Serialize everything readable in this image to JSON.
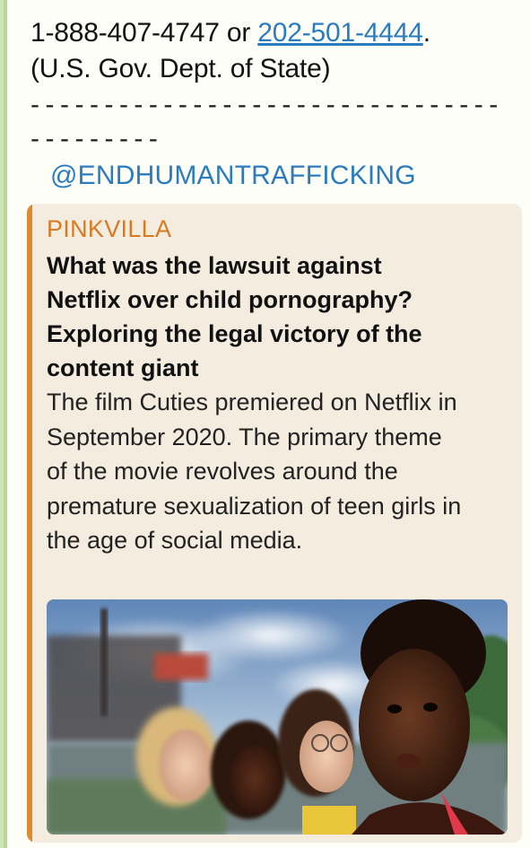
{
  "message": {
    "clipped_top_text": "...",
    "phone_line_prefix": "1-888-407-4747 or ",
    "phone_link": "202-501-4444",
    "phone_line_suffix": ".",
    "agency_line": "(U.S. Gov. Dept. of State)",
    "dash_line_1": "--------------------------------",
    "dash_line_2": "---------",
    "hashtag": "@ENDHUMANTRAFFICKING"
  },
  "link_preview": {
    "site_name": "PINKVILLA",
    "title": "What was the lawsuit against Netflix over child pornography? Exploring the legal victory of the content giant",
    "description": "The film Cuties premiered on Netflix in September 2020. The primary theme of the movie revolves around the premature sexualization of teen girls in the age of social media.",
    "accent_color": "#e08a2c",
    "link_color": "#2b7bbf"
  }
}
